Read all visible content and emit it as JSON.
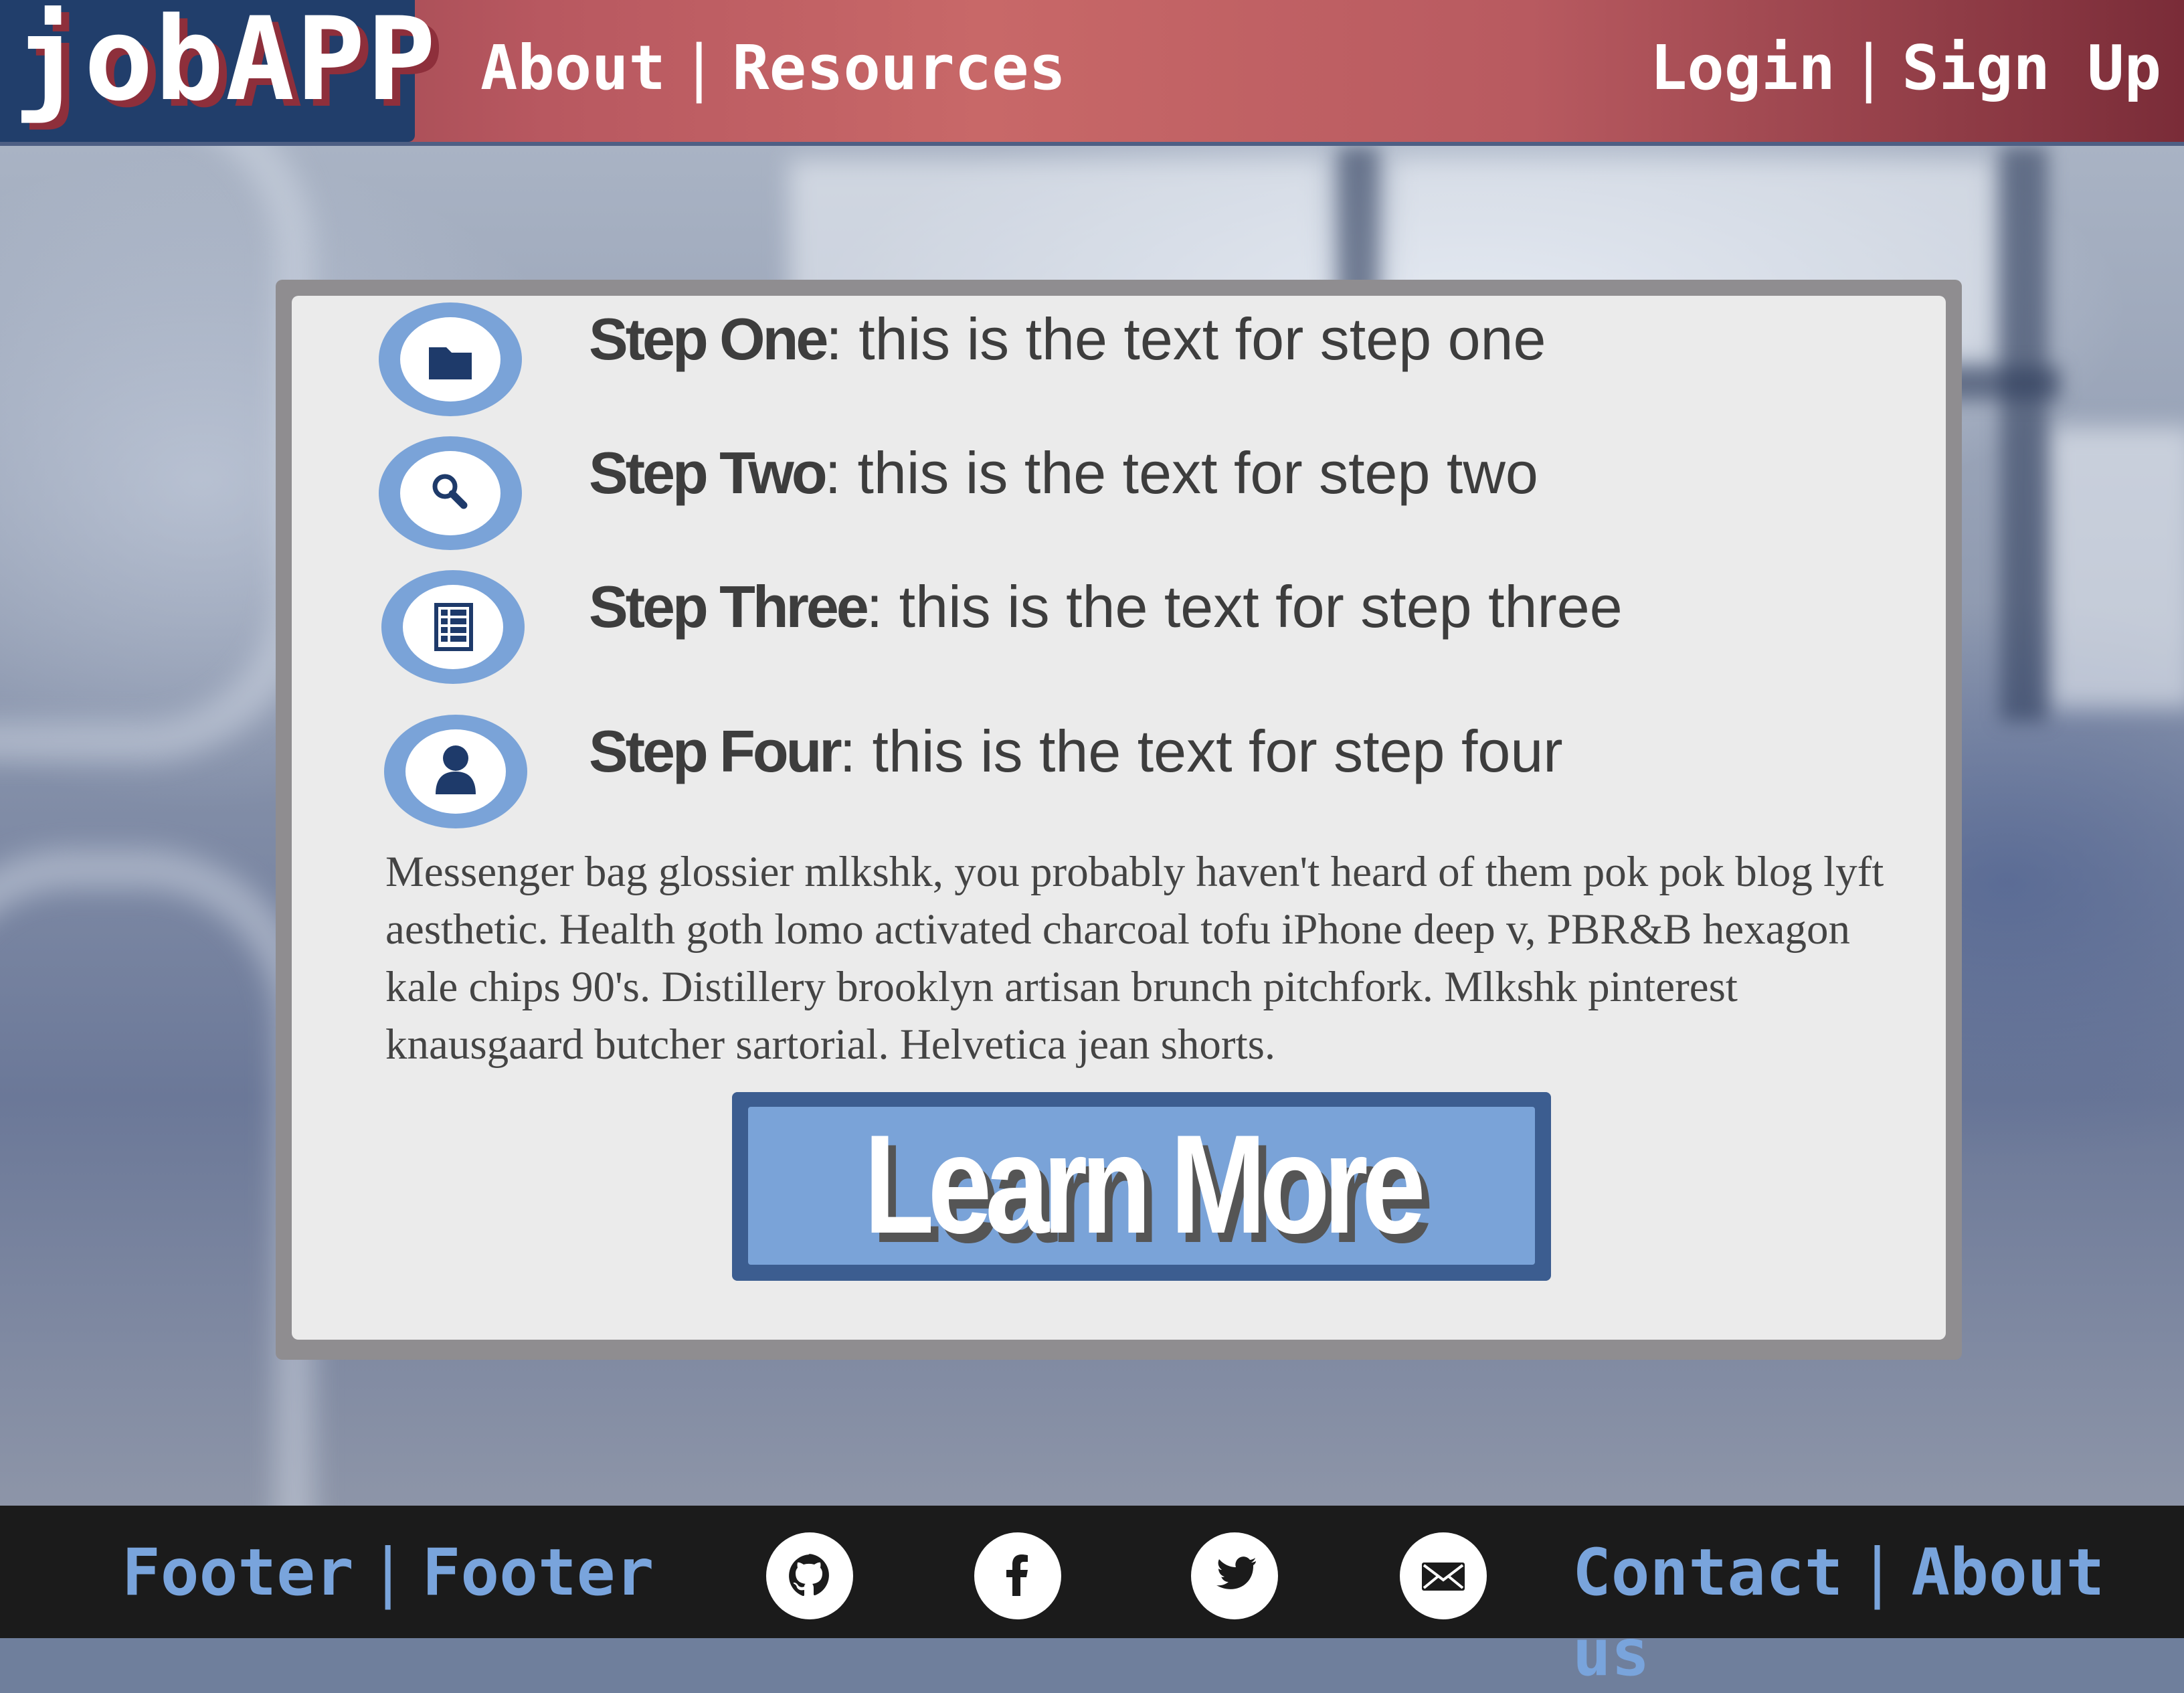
{
  "header": {
    "logo": "jobAPP",
    "nav_left": [
      "About",
      "Resources"
    ],
    "nav_right": [
      "Login",
      "Sign Up"
    ],
    "separator": "|"
  },
  "steps": [
    {
      "title": "Step One",
      "text": ": this is the text for step one",
      "icon": "folder-icon"
    },
    {
      "title": "Step Two",
      "text": ": this is the text for step two",
      "icon": "search-icon"
    },
    {
      "title": "Step Three",
      "text": ": this is the text for step three",
      "icon": "document-icon"
    },
    {
      "title": "Step Four",
      "text": ": this is the text for step four",
      "icon": "user-icon"
    }
  ],
  "main": {
    "paragraph": "Messenger bag glossier mlkshk, you probably haven't heard of them pok pok blog lyft aesthetic. Health goth lomo activated charcoal tofu iPhone deep v, PBR&B hexagon kale chips 90's. Distillery brooklyn artisan brunch pitchfork. Mlkshk pinterest knausgaard butcher sartorial. Helvetica jean shorts.",
    "cta_label": "Learn More"
  },
  "footer": {
    "left": [
      "Footer",
      "Footer"
    ],
    "right": [
      "Contact",
      "About us"
    ],
    "separator": "|",
    "social": [
      "github-icon",
      "facebook-icon",
      "twitter-icon",
      "mail-icon"
    ]
  },
  "colors": {
    "header_red": "#c86868",
    "logo_navy": "#213e6b",
    "accent_blue": "#7aa3d8",
    "cta_border": "#3c5d90",
    "footer_bg": "#1b1b1b"
  }
}
